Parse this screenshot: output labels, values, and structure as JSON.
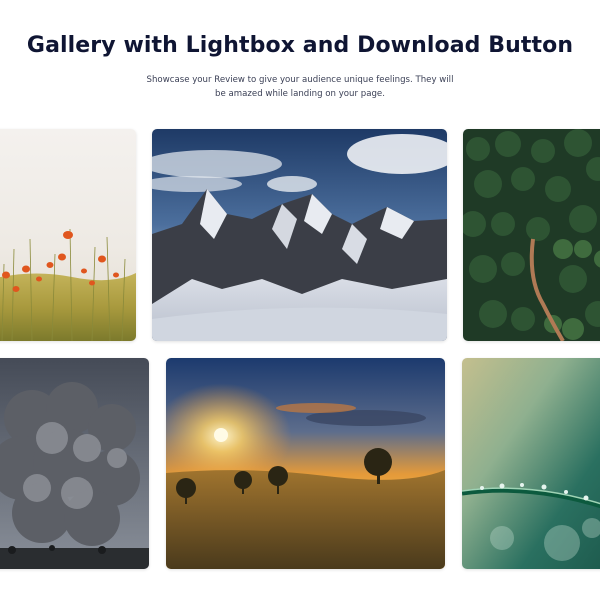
{
  "header": {
    "title": "Gallery with Lightbox and Download Button",
    "subtitle": "Showcase your Review to give your audience unique feelings. They will be amazed while landing on your page."
  },
  "gallery": {
    "items": [
      {
        "subject": "orange poppy flowers in field"
      },
      {
        "subject": "snowy mountain range"
      },
      {
        "subject": "forest with winding dirt road, aerial view"
      },
      {
        "subject": "volcanic smoke cloud"
      },
      {
        "subject": "sunset over meadow with trees"
      },
      {
        "subject": "green leaf with water droplets macro"
      }
    ]
  },
  "colors": {
    "title": "#0f1533",
    "subtitle": "#3a3f55",
    "background": "#ffffff"
  }
}
